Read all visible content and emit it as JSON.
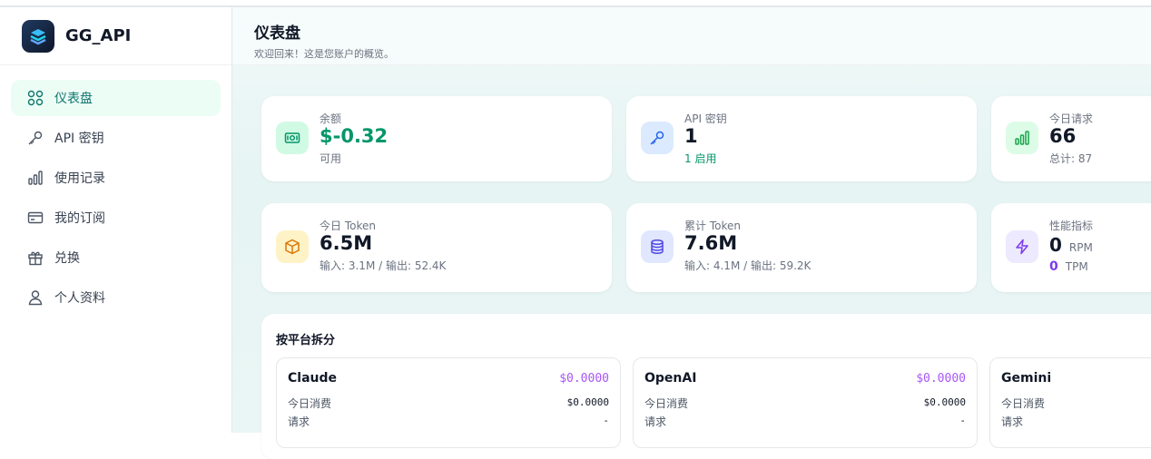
{
  "app": {
    "name": "GG_API"
  },
  "sidebar": {
    "items": [
      {
        "label": "仪表盘",
        "icon": "dashboard-grid-icon",
        "active": true
      },
      {
        "label": "API 密钥",
        "icon": "key-icon"
      },
      {
        "label": "使用记录",
        "icon": "bar-chart-icon"
      },
      {
        "label": "我的订阅",
        "icon": "credit-card-icon"
      },
      {
        "label": "兑换",
        "icon": "gift-icon"
      },
      {
        "label": "个人资料",
        "icon": "user-icon"
      }
    ]
  },
  "header": {
    "title": "仪表盘",
    "subtitle": "欢迎回来！这是您账户的概览。"
  },
  "stats": {
    "balance": {
      "label": "余额",
      "value": "$-0.32",
      "sub": "可用"
    },
    "api_keys": {
      "label": "API 密钥",
      "value": "1",
      "sub": "1 启用"
    },
    "today_requests": {
      "label": "今日请求",
      "value": "66",
      "sub": "总计: 87"
    },
    "today_tokens": {
      "label": "今日 Token",
      "value": "6.5M",
      "sub": "输入: 3.1M / 输出: 52.4K"
    },
    "total_tokens": {
      "label": "累计 Token",
      "value": "7.6M",
      "sub": "输入: 4.1M / 输出: 59.2K"
    },
    "performance": {
      "label": "性能指标",
      "rpm_value": "0",
      "rpm_unit": "RPM",
      "tpm_value": "0",
      "tpm_unit": "TPM"
    }
  },
  "platforms": {
    "title": "按平台拆分",
    "cards": [
      {
        "name": "Claude",
        "total": "$0.0000",
        "rows": [
          {
            "label": "今日消费",
            "value": "$0.0000"
          },
          {
            "label": "请求",
            "value": "-"
          }
        ]
      },
      {
        "name": "OpenAI",
        "total": "$0.0000",
        "rows": [
          {
            "label": "今日消费",
            "value": "$0.0000"
          },
          {
            "label": "请求",
            "value": "-"
          }
        ]
      },
      {
        "name": "Gemini",
        "total": "",
        "rows": [
          {
            "label": "今日消费",
            "value": ""
          },
          {
            "label": "请求",
            "value": ""
          }
        ]
      }
    ]
  },
  "colors": {
    "accent": "#059669",
    "purple": "#7c3aed",
    "active_bg": "#ecfdf5"
  }
}
